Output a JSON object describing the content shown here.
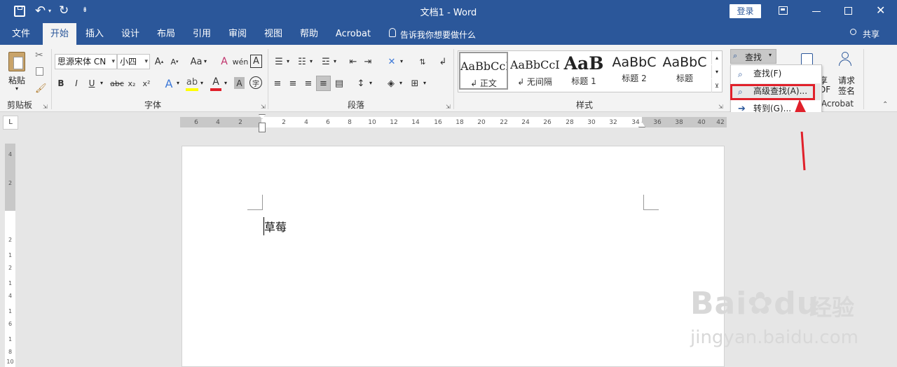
{
  "titlebar": {
    "title": "文档1  -  Word",
    "login": "登录",
    "qat_more": "⇟"
  },
  "tabs": [
    {
      "label": "文件"
    },
    {
      "label": "开始"
    },
    {
      "label": "插入"
    },
    {
      "label": "设计"
    },
    {
      "label": "布局"
    },
    {
      "label": "引用"
    },
    {
      "label": "审阅"
    },
    {
      "label": "视图"
    },
    {
      "label": "帮助"
    },
    {
      "label": "Acrobat"
    }
  ],
  "tell_me": "告诉我你想要做什么",
  "share": "共享",
  "ribbon": {
    "clipboard": {
      "paste": "粘贴",
      "group": "剪贴板"
    },
    "font": {
      "name": "思源宋体 CN",
      "size": "小四",
      "case_btn": "Aa",
      "bold": "B",
      "italic": "I",
      "underline": "U",
      "strike": "abc",
      "sub": "x₂",
      "sup": "x²",
      "group": "字体"
    },
    "paragraph": {
      "group": "段落"
    },
    "styles": {
      "items": [
        {
          "sample": "AaBbCcDc",
          "name": "↲ 正文"
        },
        {
          "sample": "AaBbCcDc",
          "name": "↲ 无间隔"
        },
        {
          "sample": "AaB",
          "name": "标题 1"
        },
        {
          "sample": "AaBbC",
          "name": "标题 2"
        },
        {
          "sample": "AaBbC",
          "name": "标题"
        }
      ],
      "group": "样式"
    },
    "editing": {
      "find": "查找"
    },
    "share_pdf": {
      "line1": "享",
      "line2": "DF"
    },
    "sign": {
      "line1": "请求",
      "line2": "签名"
    },
    "acrobat_group": "Acrobat"
  },
  "find_menu": {
    "items": [
      {
        "label": "查找(F)"
      },
      {
        "label": "高级查找(A)..."
      },
      {
        "label": "转到(G)..."
      }
    ]
  },
  "ruler": {
    "h_labels": [
      "6",
      "4",
      "2",
      "",
      "2",
      "4",
      "6",
      "8",
      "10",
      "12",
      "14",
      "16",
      "18",
      "20",
      "22",
      "24",
      "26",
      "28",
      "30",
      "32",
      "34",
      "36",
      "38",
      "40",
      "42"
    ],
    "v_labels": [
      "4",
      "2",
      "2",
      "1",
      "2",
      "1",
      "4",
      "1",
      "6",
      "1",
      "8",
      "1",
      "10"
    ]
  },
  "document": {
    "text": "草莓"
  },
  "watermark": {
    "logo": "Bai",
    "logo2": "du",
    "site": "经验",
    "url": "jingyan.baidu.com"
  },
  "colors": {
    "brand": "#2b579a",
    "highlight_box": "#e0202a",
    "arrow": "#e0202a"
  }
}
